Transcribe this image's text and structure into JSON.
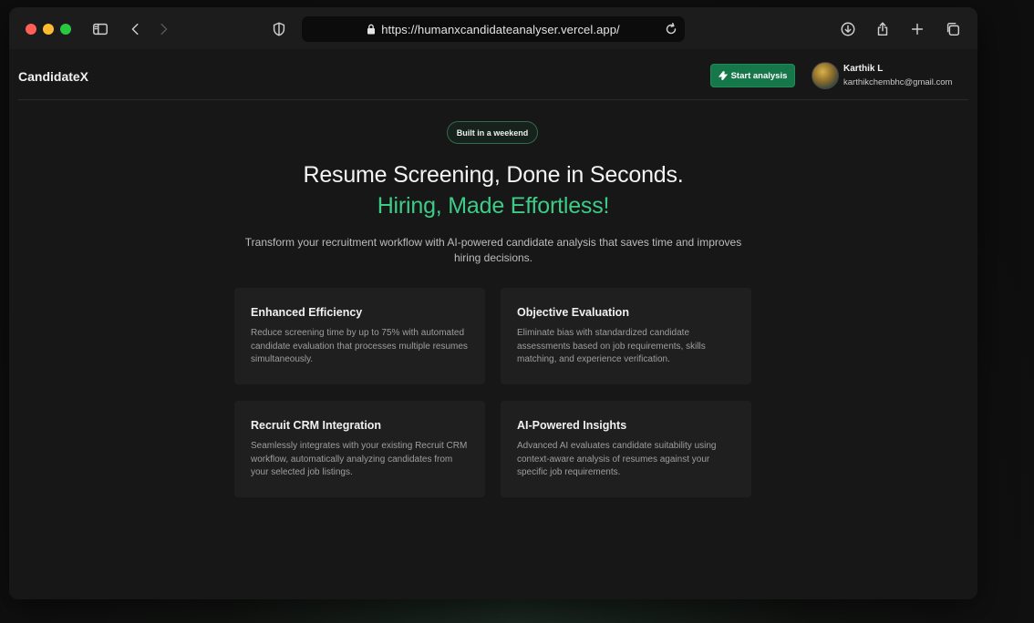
{
  "browser": {
    "url": "https://humanxcandidateanalyser.vercel.app/"
  },
  "header": {
    "brand": "CandidateX",
    "start_button_label": "Start analysis",
    "user_name": "Karthik L",
    "user_email": "karthikchembhc@gmail.com"
  },
  "hero": {
    "badge": "Built in a weekend",
    "headline": "Resume Screening, Done in Seconds.",
    "headline_accent": "Hiring, Made Effortless!",
    "subtitle": "Transform your recruitment workflow with AI-powered candidate analysis that saves time and improves hiring decisions."
  },
  "features": [
    {
      "title": "Enhanced Efficiency",
      "text": "Reduce screening time by up to 75% with automated candidate evaluation that processes multiple resumes simultaneously."
    },
    {
      "title": "Objective Evaluation",
      "text": "Eliminate bias with standardized candidate assessments based on job requirements, skills matching, and experience verification."
    },
    {
      "title": "Recruit CRM Integration",
      "text": "Seamlessly integrates with your existing Recruit CRM workflow, automatically analyzing candidates from your selected job listings."
    },
    {
      "title": "AI-Powered Insights",
      "text": "Advanced AI evaluates candidate suitability using context-aware analysis of resumes against your specific job requirements."
    }
  ],
  "colors": {
    "accent": "#3ecb86",
    "button": "#16774a",
    "background": "#171717"
  }
}
